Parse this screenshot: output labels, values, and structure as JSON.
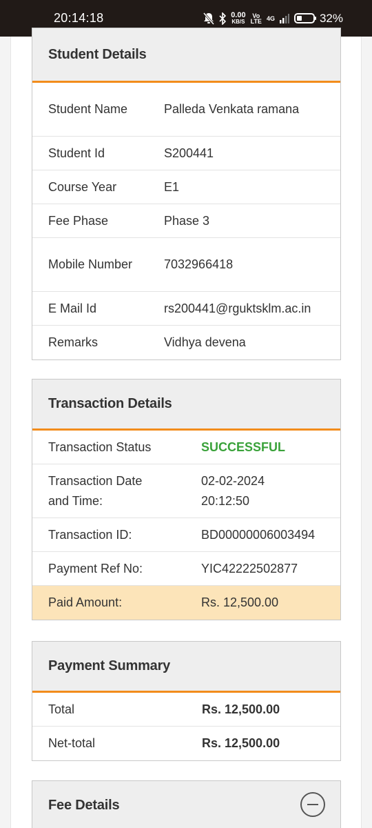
{
  "status_bar": {
    "time": "20:14:18",
    "net_speed": "0.00",
    "net_unit": "KB/S",
    "volte_top": "Vo",
    "volte_bottom": "LTE",
    "network": "4G",
    "battery_percent": "32%",
    "battery_level": 0.32,
    "icons": [
      "bell-muted-icon",
      "bluetooth-icon",
      "signal-icon",
      "battery-icon"
    ]
  },
  "student_details": {
    "title": "Student Details",
    "rows": [
      {
        "label": "Student Name",
        "value": "Palleda Venkata ramana"
      },
      {
        "label": "Student Id",
        "value": "S200441"
      },
      {
        "label": "Course Year",
        "value": "E1"
      },
      {
        "label": "Fee Phase",
        "value": "Phase 3"
      },
      {
        "label": "Mobile Number",
        "value": "7032966418"
      },
      {
        "label": "E Mail Id",
        "value": "rs200441@rguktsklm.ac.in"
      },
      {
        "label": "Remarks",
        "value": "Vidhya devena"
      }
    ]
  },
  "transaction_details": {
    "title": "Transaction Details",
    "rows": [
      {
        "label": "Transaction Status",
        "value": "SUCCESSFUL"
      },
      {
        "label": "Transaction Date and Time:",
        "value": "02-02-2024 20:12:50"
      },
      {
        "label": "Transaction ID:",
        "value": "BD00000006003494"
      },
      {
        "label": "Payment Ref No:",
        "value": "YIC42222502877"
      },
      {
        "label": "Paid Amount:",
        "value": "Rs. 12,500.00"
      }
    ]
  },
  "payment_summary": {
    "title": "Payment Summary",
    "rows": [
      {
        "label": "Total",
        "value": "Rs. 12,500.00"
      },
      {
        "label": "Net-total",
        "value": "Rs. 12,500.00"
      }
    ]
  },
  "fee_details": {
    "title": "Fee Details"
  },
  "colors": {
    "accent": "#f28c1b",
    "success": "#3aa23a",
    "highlight": "#fce4b9"
  }
}
